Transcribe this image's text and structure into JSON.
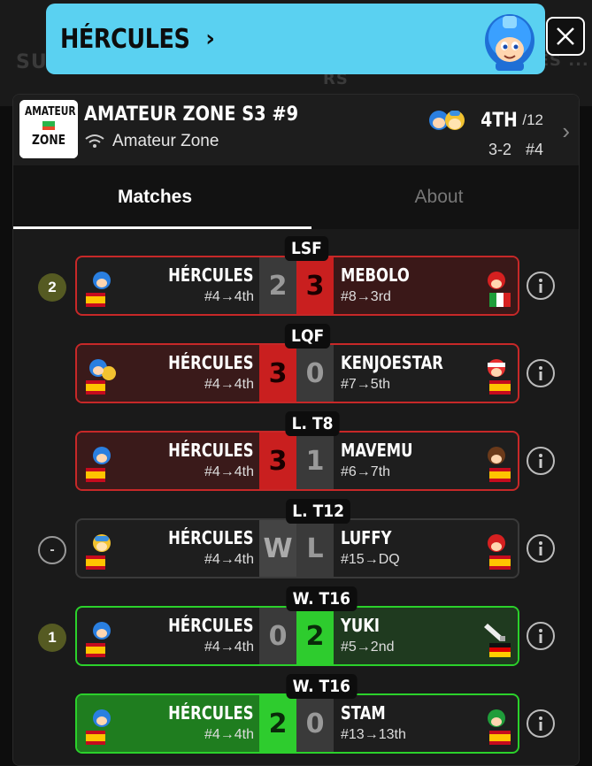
{
  "background": {
    "left_text": "SU",
    "right_text": "ALL STANDING MATCHES ... RS"
  },
  "banner": {
    "title": "HÉRCULES",
    "chevron": "›",
    "close_icon": "close-icon"
  },
  "tournament": {
    "logo_lines": [
      "AMATEUR",
      "ZONE"
    ],
    "name": "AMATEUR ZONE S3 #9",
    "online_icon": "wifi-icon",
    "organizer": "Amateur Zone",
    "placement": "4TH",
    "placement_total": "/12",
    "record": "3-2",
    "seed": "#4"
  },
  "tabs": [
    {
      "label": "Matches",
      "active": true
    },
    {
      "label": "About",
      "active": false
    }
  ],
  "matches": [
    {
      "round": "LSF",
      "badge": "2",
      "player": {
        "name": "HÉRCULES",
        "seed": "#4→4th",
        "flag": "spain"
      },
      "player_score": "2",
      "opponent_score": "3",
      "opponent": {
        "name": "MEBOLO",
        "seed": "#8→3rd",
        "flag": "italy"
      },
      "result": "loss"
    },
    {
      "round": "LQF",
      "badge": "",
      "player": {
        "name": "HÉRCULES",
        "seed": "#4→4th",
        "flag": "spain"
      },
      "player_score": "3",
      "opponent_score": "0",
      "opponent": {
        "name": "KENJOESTAR",
        "seed": "#7→5th",
        "flag": "spain"
      },
      "result": "win-red"
    },
    {
      "round": "L. T8",
      "badge": "",
      "player": {
        "name": "HÉRCULES",
        "seed": "#4→4th",
        "flag": "spain"
      },
      "player_score": "3",
      "opponent_score": "1",
      "opponent": {
        "name": "MAVEMU",
        "seed": "#6→7th",
        "flag": "spain"
      },
      "result": "win-red"
    },
    {
      "round": "L. T12",
      "badge": "-",
      "player": {
        "name": "HÉRCULES",
        "seed": "#4→4th",
        "flag": "spain"
      },
      "player_score": "W",
      "opponent_score": "L",
      "opponent": {
        "name": "LUFFY",
        "seed": "#15→DQ",
        "flag": "spain"
      },
      "result": "dq"
    },
    {
      "round": "W. T16",
      "badge": "1",
      "player": {
        "name": "HÉRCULES",
        "seed": "#4→4th",
        "flag": "spain"
      },
      "player_score": "0",
      "opponent_score": "2",
      "opponent": {
        "name": "YUKI",
        "seed": "#5→2nd",
        "flag": "germany"
      },
      "result": "loss-green"
    },
    {
      "round": "W. T16",
      "badge": "",
      "player": {
        "name": "HÉRCULES",
        "seed": "#4→4th",
        "flag": "spain"
      },
      "player_score": "2",
      "opponent_score": "0",
      "opponent": {
        "name": "STAM",
        "seed": "#13→13th",
        "flag": "spain"
      },
      "result": "win-green"
    }
  ],
  "colors": {
    "banner": "#5ad1f1",
    "loss_red": "#c91f1f",
    "win_green": "#2ecc2e",
    "badge_olive": "#555a22"
  }
}
